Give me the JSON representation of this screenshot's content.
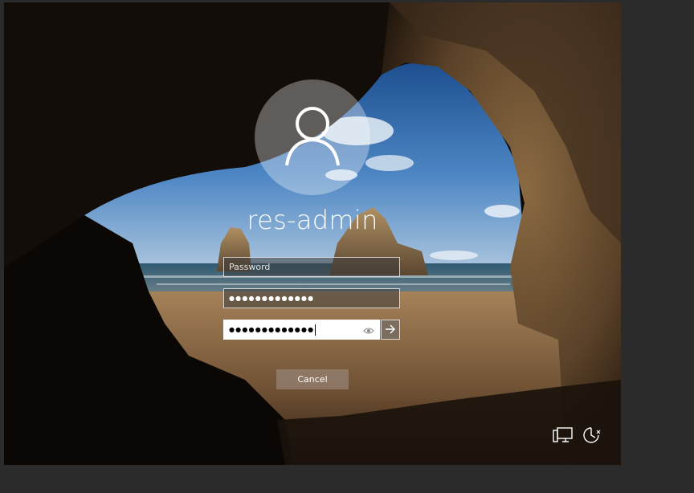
{
  "login": {
    "username": "res-admin",
    "fields": [
      {
        "type": "password",
        "placeholder": "Password",
        "value": "",
        "masked": ""
      },
      {
        "type": "password",
        "placeholder": "",
        "value": "",
        "masked": "●●●●●●●●●●●●●"
      },
      {
        "type": "password",
        "placeholder": "",
        "value": "",
        "masked": "●●●●●●●●●●●●●",
        "focused": true
      }
    ],
    "cancel_label": "Cancel"
  },
  "icons": {
    "avatar": "user-icon",
    "reveal": "eye-icon",
    "submit": "arrow-right-icon",
    "network": "network-icon",
    "ease_of_access": "ease-of-access-icon"
  },
  "colors": {
    "outer_background": "#2b2b2b",
    "field_background": "#3c3c3c",
    "cancel_button": "#96826f",
    "text": "#ffffff"
  }
}
